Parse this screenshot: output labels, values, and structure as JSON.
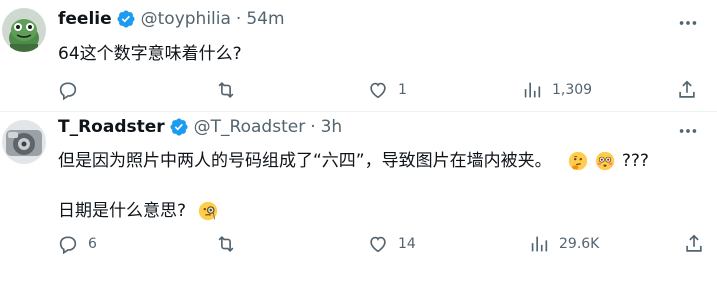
{
  "tweets": [
    {
      "name": "feelie",
      "handle": "@toyphilia",
      "separator": "·",
      "time": "54m",
      "text": "64这个数字意味着什么?",
      "replies": "",
      "retweets": "",
      "likes": "1",
      "views": "1,309"
    },
    {
      "name": "T_Roadster",
      "handle": "@T_Roadster",
      "separator": "·",
      "time": "3h",
      "text_line1": "但是因为照片中两人的号码组成了“六四”，导致图片在墙内被夹。",
      "text_line1_suffix": "???",
      "text_line2": "日期是什么意思?",
      "replies": "6",
      "retweets": "",
      "likes": "14",
      "views": "29.6K"
    }
  ],
  "icons": {
    "verified": "verified-badge-icon",
    "more": "more-icon",
    "reply": "reply-icon",
    "retweet": "retweet-icon",
    "like": "heart-icon",
    "views": "views-icon",
    "share": "share-icon"
  },
  "colors": {
    "verified_blue": "#1d9bf0",
    "secondary_text": "#536471",
    "primary_text": "#0f1419"
  }
}
